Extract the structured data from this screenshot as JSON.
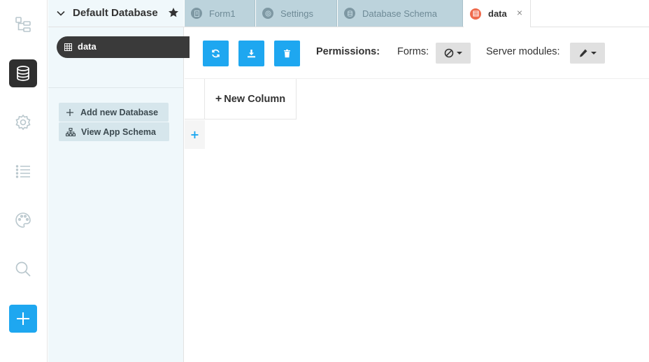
{
  "rail": {
    "items": [
      {
        "name": "app-tree-icon"
      },
      {
        "name": "database-icon",
        "active": true
      },
      {
        "name": "settings-gear-icon"
      },
      {
        "name": "list-icon"
      },
      {
        "name": "palette-icon"
      },
      {
        "name": "search-icon"
      },
      {
        "name": "add-plus-icon"
      }
    ]
  },
  "explorer": {
    "title": "Default Database",
    "tables": [
      {
        "label": "data"
      }
    ],
    "add_database_label": "Add new Database",
    "view_schema_label": "View App Schema"
  },
  "tabs": [
    {
      "label": "Form1",
      "icon": "form-icon"
    },
    {
      "label": "Settings",
      "icon": "gear-icon"
    },
    {
      "label": "Database Schema",
      "icon": "database-icon"
    },
    {
      "label": "data",
      "icon": "table-icon",
      "active": true,
      "close": "×"
    }
  ],
  "toolbar": {
    "refresh_icon": "refresh-icon",
    "download_icon": "download-icon",
    "delete_icon": "trash-icon",
    "permissions_label": "Permissions:",
    "forms_label": "Forms:",
    "forms_value_icon": "no-access-icon",
    "server_modules_label": "Server modules:",
    "server_modules_value_icon": "pencil-icon"
  },
  "grid": {
    "new_column_plus": "+",
    "new_column_label": "New Column",
    "add_row_label": "+"
  },
  "colors": {
    "accent": "#1ea7f0",
    "rail_active": "#2f2f2f",
    "explorer_bg": "#f0f8fb",
    "tab_inactive": "#bcd3dc",
    "tab_active_icon": "#ef6a4c"
  }
}
